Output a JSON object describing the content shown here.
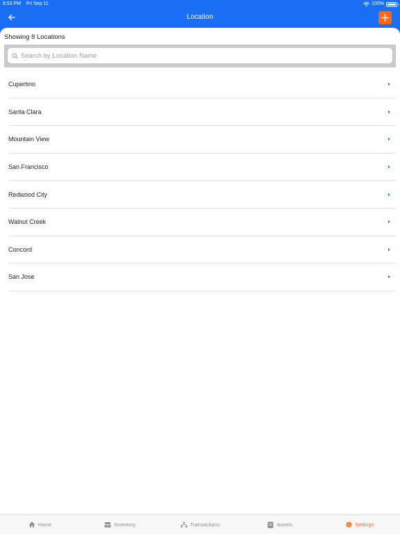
{
  "status_bar": {
    "time": "6:53 PM",
    "date": "Fri Sep 11",
    "battery": "100%",
    "battery_level": 1.0
  },
  "nav": {
    "title": "Location"
  },
  "count_text": "Showing 8 Locations",
  "search": {
    "placeholder": "Search by Location Name",
    "value": ""
  },
  "locations": [
    "Cupertino",
    "Santa Clara",
    "Mountain View",
    "San Francisco",
    "Redwood City",
    "Walnut Creek",
    "Concord",
    "San Jose"
  ],
  "tabs": [
    {
      "label": "Home",
      "icon": "home-icon"
    },
    {
      "label": "Inventory",
      "icon": "inventory-icon"
    },
    {
      "label": "Transactions",
      "icon": "transactions-icon"
    },
    {
      "label": "Assets",
      "icon": "assets-icon"
    },
    {
      "label": "Settings",
      "icon": "gear-icon",
      "active": true
    }
  ],
  "colors": {
    "primary": "#1b6ff5",
    "accent": "#f46a1a",
    "tab_inactive": "#8e8e8e"
  }
}
